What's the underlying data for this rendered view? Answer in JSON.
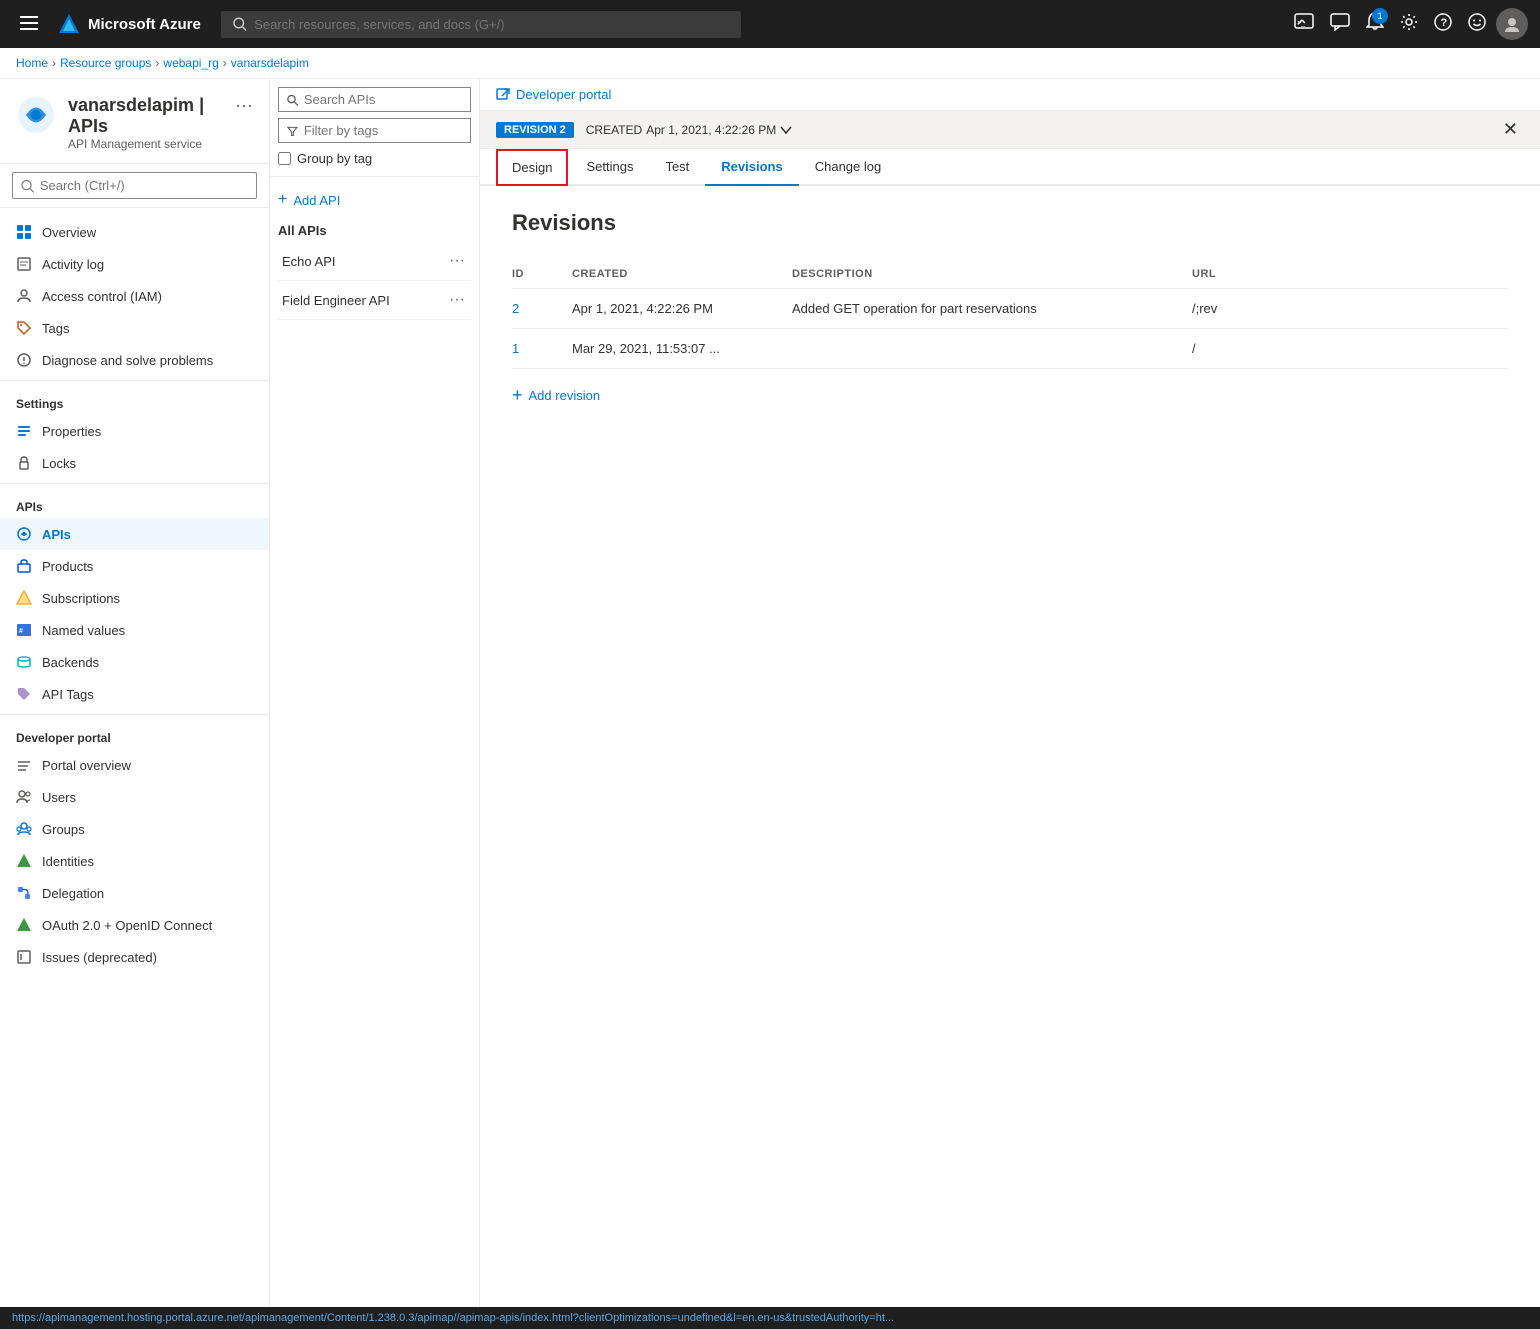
{
  "topbar": {
    "logo_text": "Microsoft Azure",
    "search_placeholder": "Search resources, services, and docs (G+/)",
    "notification_count": "1"
  },
  "breadcrumb": {
    "items": [
      "Home",
      "Resource groups",
      "webapi_rg",
      "vanarsdelapim"
    ]
  },
  "resource": {
    "name": "vanarsdelapim",
    "separator": "|",
    "section": "APIs",
    "subtitle": "API Management service"
  },
  "sidebar": {
    "search_placeholder": "Search (Ctrl+/)",
    "nav_items": [
      {
        "id": "overview",
        "label": "Overview",
        "icon": "overview"
      },
      {
        "id": "activity-log",
        "label": "Activity log",
        "icon": "activity-log"
      },
      {
        "id": "access-control",
        "label": "Access control (IAM)",
        "icon": "iam"
      },
      {
        "id": "tags",
        "label": "Tags",
        "icon": "tags"
      },
      {
        "id": "diagnose",
        "label": "Diagnose and solve problems",
        "icon": "diagnose"
      }
    ],
    "settings_section": "Settings",
    "settings_items": [
      {
        "id": "properties",
        "label": "Properties",
        "icon": "properties"
      },
      {
        "id": "locks",
        "label": "Locks",
        "icon": "locks"
      }
    ],
    "apis_section": "APIs",
    "apis_items": [
      {
        "id": "apis",
        "label": "APIs",
        "icon": "apis",
        "active": true
      },
      {
        "id": "products",
        "label": "Products",
        "icon": "products"
      },
      {
        "id": "subscriptions",
        "label": "Subscriptions",
        "icon": "subscriptions"
      },
      {
        "id": "named-values",
        "label": "Named values",
        "icon": "named-values"
      },
      {
        "id": "backends",
        "label": "Backends",
        "icon": "backends"
      },
      {
        "id": "api-tags",
        "label": "API Tags",
        "icon": "api-tags"
      }
    ],
    "developer_portal_section": "Developer portal",
    "developer_portal_items": [
      {
        "id": "portal-overview",
        "label": "Portal overview",
        "icon": "portal-overview"
      },
      {
        "id": "users",
        "label": "Users",
        "icon": "users"
      },
      {
        "id": "groups",
        "label": "Groups",
        "icon": "groups"
      },
      {
        "id": "identities",
        "label": "Identities",
        "icon": "identities"
      },
      {
        "id": "delegation",
        "label": "Delegation",
        "icon": "delegation"
      },
      {
        "id": "oauth",
        "label": "OAuth 2.0 + OpenID Connect",
        "icon": "oauth"
      },
      {
        "id": "issues",
        "label": "Issues (deprecated)",
        "icon": "issues"
      }
    ]
  },
  "api_panel": {
    "search_placeholder": "Search APIs",
    "filter_placeholder": "Filter by tags",
    "group_by_tag": "Group by tag",
    "add_api_label": "Add API",
    "all_apis_label": "All APIs",
    "apis": [
      {
        "id": "echo-api",
        "label": "Echo API"
      },
      {
        "id": "field-engineer-api",
        "label": "Field Engineer API"
      }
    ]
  },
  "dev_portal": {
    "link_label": "Developer portal",
    "link_icon": "external-link"
  },
  "revision_bar": {
    "badge": "REVISION 2",
    "created_label": "CREATED",
    "created_date": "Apr 1, 2021, 4:22:26 PM"
  },
  "tabs": {
    "items": [
      {
        "id": "design",
        "label": "Design",
        "active": false,
        "highlighted": true
      },
      {
        "id": "settings",
        "label": "Settings",
        "active": false
      },
      {
        "id": "test",
        "label": "Test",
        "active": false
      },
      {
        "id": "revisions",
        "label": "Revisions",
        "active": true
      },
      {
        "id": "change-log",
        "label": "Change log",
        "active": false
      }
    ]
  },
  "revisions_page": {
    "title": "Revisions",
    "columns": [
      {
        "id": "id",
        "label": "ID"
      },
      {
        "id": "created",
        "label": "CREATED"
      },
      {
        "id": "description",
        "label": "DESCRIPTION"
      },
      {
        "id": "url",
        "label": "URL"
      }
    ],
    "rows": [
      {
        "id": "2",
        "created": "Apr 1, 2021, 4:22:26 PM",
        "description": "Added GET operation for part reservations",
        "url": "/;rev"
      },
      {
        "id": "1",
        "created": "Mar 29, 2021, 11:53:07 ...",
        "description": "",
        "url": "/"
      }
    ],
    "add_revision_label": "Add revision"
  },
  "status_bar": {
    "url": "https://apimanagement.hosting.portal.azure.net/apimanagement/Content/1.238.0.3/apimap//apimap-apis/index.html?clientOptimizations=undefined&l=en.en-us&trustedAuthority=ht..."
  }
}
